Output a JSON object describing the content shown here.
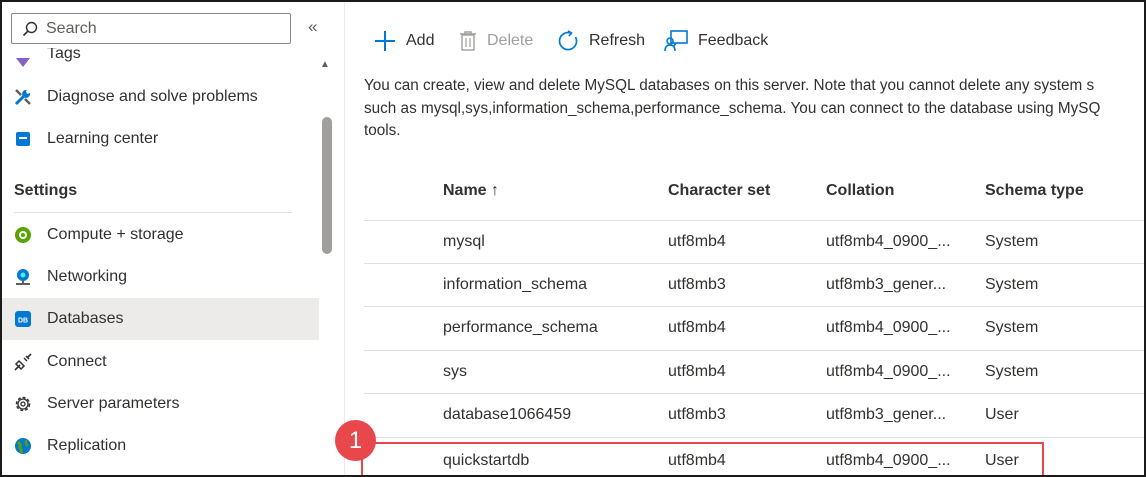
{
  "sidebar": {
    "search_placeholder": "Search",
    "collapse_glyph": "«",
    "items_top": [
      {
        "label": "Tags",
        "icon": "tag-icon"
      },
      {
        "label": "Diagnose and solve problems",
        "icon": "wrench-icon"
      },
      {
        "label": "Learning center",
        "icon": "learning-center-icon"
      }
    ],
    "section_title": "Settings",
    "settings_items": [
      {
        "label": "Compute + storage",
        "icon": "compute-storage-icon"
      },
      {
        "label": "Networking",
        "icon": "networking-icon"
      },
      {
        "label": "Databases",
        "icon": "database-icon",
        "selected": true
      },
      {
        "label": "Connect",
        "icon": "plug-icon"
      },
      {
        "label": "Server parameters",
        "icon": "gear-icon"
      },
      {
        "label": "Replication",
        "icon": "globe-icon"
      }
    ]
  },
  "toolbar": {
    "add_label": "Add",
    "delete_label": "Delete",
    "refresh_label": "Refresh",
    "feedback_label": "Feedback"
  },
  "description": {
    "line1": "You can create, view and delete MySQL databases on this server. Note that you cannot delete any system s",
    "line2": "such as mysql,sys,information_schema,performance_schema. You can connect to the database using MySQ",
    "line3": "tools."
  },
  "table": {
    "columns": [
      "Name ↑",
      "Character set",
      "Collation",
      "Schema type"
    ],
    "rows": [
      {
        "name": "mysql",
        "charset": "utf8mb4",
        "collation": "utf8mb4_0900_...",
        "schema": "System"
      },
      {
        "name": "information_schema",
        "charset": "utf8mb3",
        "collation": "utf8mb3_gener...",
        "schema": "System"
      },
      {
        "name": "performance_schema",
        "charset": "utf8mb4",
        "collation": "utf8mb4_0900_...",
        "schema": "System"
      },
      {
        "name": "sys",
        "charset": "utf8mb4",
        "collation": "utf8mb4_0900_...",
        "schema": "System"
      },
      {
        "name": "database1066459",
        "charset": "utf8mb3",
        "collation": "utf8mb3_gener...",
        "schema": "User"
      },
      {
        "name": "quickstartdb",
        "charset": "utf8mb4",
        "collation": "utf8mb4_0900_...",
        "schema": "User"
      }
    ]
  },
  "callout": {
    "number": "1"
  },
  "colors": {
    "accent": "#0078d4",
    "callout": "#e8474c",
    "selected_bg": "#edebe9"
  }
}
